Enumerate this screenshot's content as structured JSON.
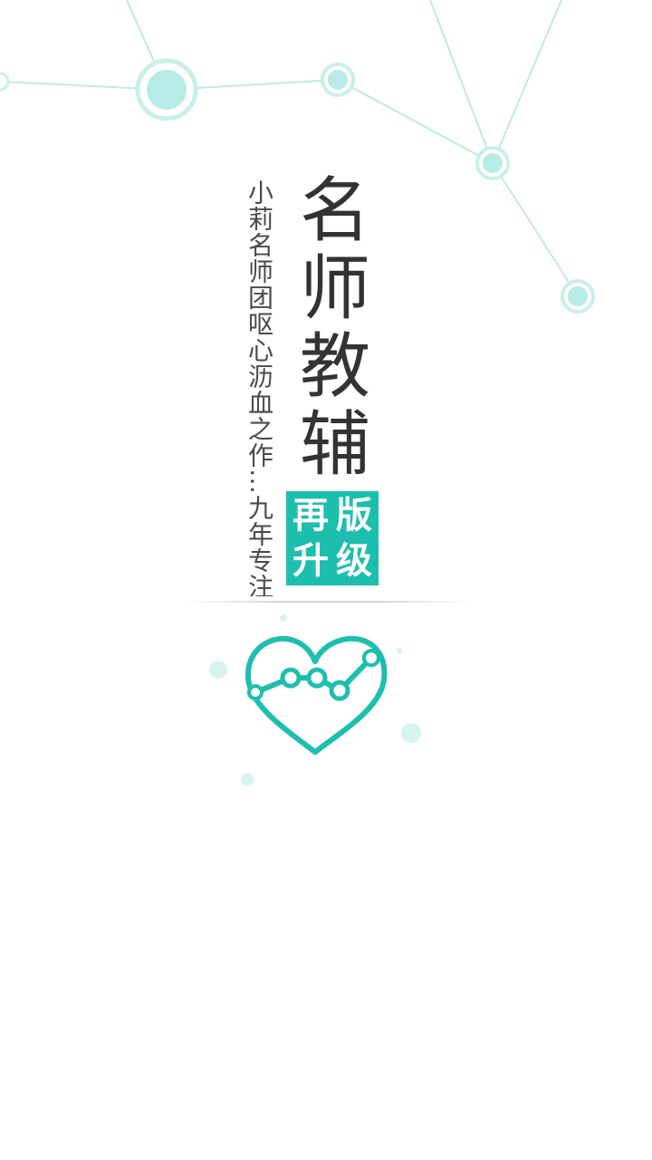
{
  "splash": {
    "title_chars": [
      "名",
      "师",
      "教",
      "辅"
    ],
    "badge_chars": [
      "再",
      "版",
      "升",
      "级"
    ],
    "slogan": "小莉名师团呕心沥血之作…九年专注"
  },
  "colors": {
    "accent": "#1cbfae",
    "node_fill": "#b6ebe6",
    "node_ring": "#c9efeb",
    "line": "#bfeae5",
    "title_text": "#333333",
    "slogan_text": "#4a4a4a",
    "background": "#ffffff"
  },
  "icons": {
    "logo": "heart-network-icon",
    "background": "network-nodes-decoration"
  }
}
